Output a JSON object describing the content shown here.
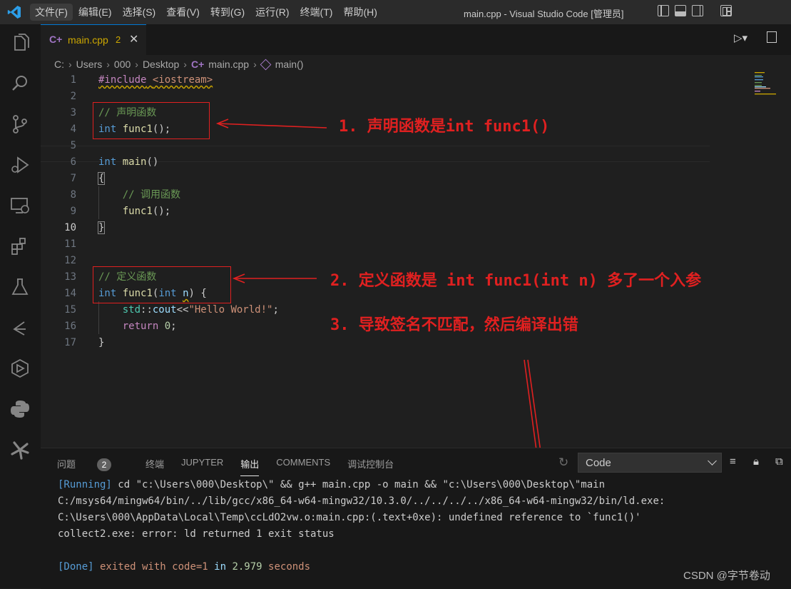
{
  "app": {
    "window_title": "main.cpp - Visual Studio Code [管理员]",
    "menu": [
      "文件(F)",
      "编辑(E)",
      "选择(S)",
      "查看(V)",
      "转到(G)",
      "运行(R)",
      "终端(T)",
      "帮助(H)"
    ]
  },
  "activity_bar": [
    "explorer-icon",
    "search-icon",
    "source-control-icon",
    "run-debug-icon",
    "remote-explorer-icon",
    "extensions-icon",
    "testing-icon",
    "git-graph-icon",
    "cmake-icon",
    "python-icon",
    "settings-extension-icon"
  ],
  "tab": {
    "glyph": "C+",
    "name": "main.cpp",
    "problems": "2",
    "close": "✕"
  },
  "breadcrumbs": [
    "C:",
    "Users",
    "000",
    "Desktop",
    "main.cpp",
    "main()"
  ],
  "editor": {
    "line_numbers": [
      "1",
      "2",
      "3",
      "4",
      "5",
      "6",
      "7",
      "8",
      "9",
      "10",
      "11",
      "12",
      "13",
      "14",
      "15",
      "16",
      "17"
    ],
    "current_line": "10",
    "code": {
      "l1_pp": "#include",
      "l1_inc": "<iostream>",
      "l3": "// 声明函数",
      "l4_kw": "int",
      "l4_fn": "func1",
      "l4_rest": "();",
      "l6_kw": "int",
      "l6_fn": "main",
      "l6_rest": "()",
      "l7": "{",
      "l8": "// 调用函数",
      "l9_fn": "func1",
      "l9_rest": "();",
      "l10": "}",
      "l13": "// 定义函数",
      "l14_kw": "int",
      "l14_fn": "func1",
      "l14_p1": "(",
      "l14_kw2": "int",
      "l14_v": "n",
      "l14_rest": ") {",
      "l15_ns": "std",
      "l15_op": "::",
      "l15_v": "cout",
      "l15_op2": "<<",
      "l15_s": "\"Hello World!\"",
      "l15_end": ";",
      "l16_kw": "return",
      "l16_n": "0",
      "l16_end": ";",
      "l17": "}"
    }
  },
  "annotations": {
    "a1": "1. 声明函数是int func1()",
    "a2": "2. 定义函数是  int func1(int n)  多了一个入参",
    "a3": "3. 导致签名不匹配，然后编译出错"
  },
  "panel": {
    "tabs": [
      "问题",
      "终端",
      "JUPYTER",
      "输出",
      "COMMENTS",
      "调试控制台"
    ],
    "problems_count": "2",
    "active_tab": "输出",
    "output_channel": "Code",
    "output": {
      "l1_tag": "[Running]",
      "l1_cmd": " cd \"c:\\Users\\000\\Desktop\\\" && g++ main.cpp -o main && \"c:\\Users\\000\\Desktop\\\"main",
      "l2": "C:/msys64/mingw64/bin/../lib/gcc/x86_64-w64-mingw32/10.3.0/../../../../x86_64-w64-mingw32/bin/ld.exe:",
      "l3_a": "C:\\Users\\000\\AppData\\Local\\Temp\\ccLdO2vw.o:main.cpp:(.text+0xe): ",
      "l3_b": "undefined reference to `func1()'",
      "l4": "collect2.exe: error: ld returned 1 exit status",
      "l6_tag": "[Done]",
      "l6_a": " exited with ",
      "l6_code": "code=1",
      "l6_b": " in ",
      "l6_num": "2.979",
      "l6_c": " seconds"
    }
  },
  "watermark": "CSDN @字节卷动",
  "colors": {
    "accent": "#0078d4",
    "annotation_red": "#e02020",
    "warning": "#cca700"
  }
}
